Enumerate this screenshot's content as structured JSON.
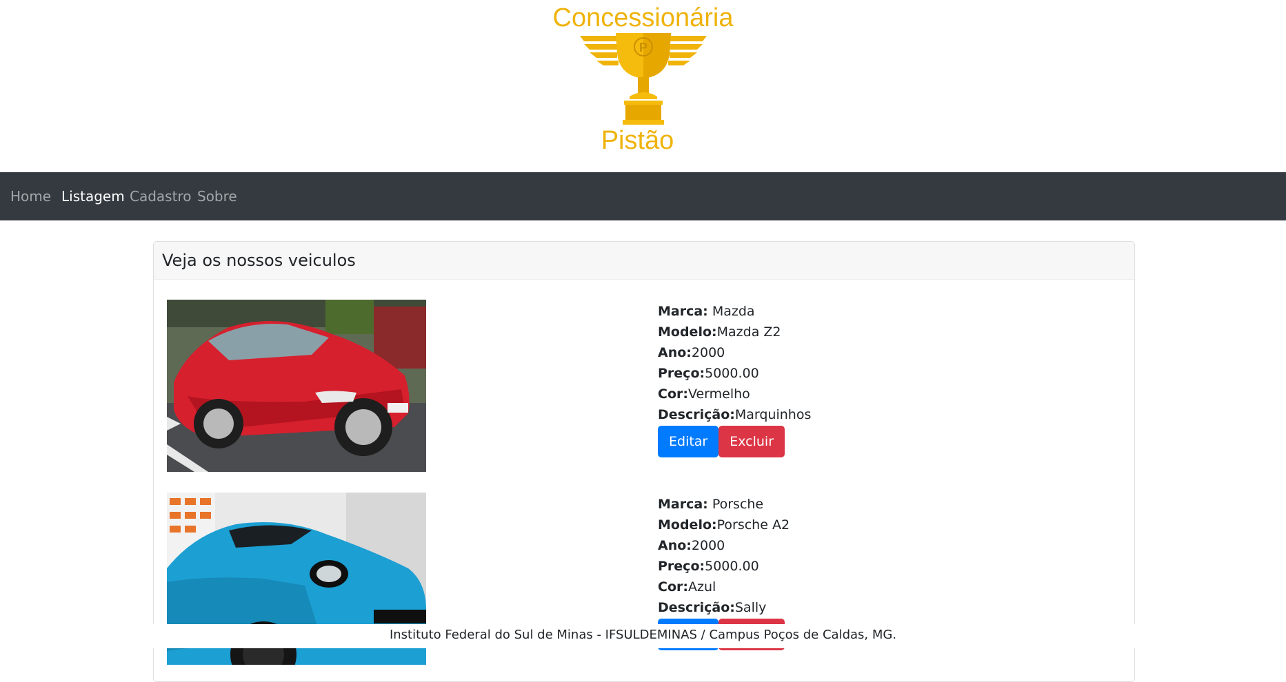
{
  "brand": {
    "name_top": "Concessionária",
    "name_bottom": "Pistão",
    "emblem_letter": "P",
    "color": "#efb30a"
  },
  "nav": {
    "items": [
      {
        "label": "Home"
      },
      {
        "label": "Listagem"
      },
      {
        "label": "Cadastro"
      },
      {
        "label": "Sobre"
      }
    ],
    "active": "Listagem",
    "background": "#343a40"
  },
  "listing": {
    "title": "Veja os nossos veiculos",
    "labels": {
      "marca": "Marca:",
      "modelo": "Modelo:",
      "ano": "Ano:",
      "preco": "Preço:",
      "cor": "Cor:",
      "descricao": "Descrição:"
    },
    "buttons": {
      "edit": "Editar",
      "delete": "Excluir"
    },
    "vehicles": [
      {
        "marca": "Mazda",
        "modelo": "Mazda Z2",
        "ano": "2000",
        "preco": "5000.00",
        "cor": "Vermelho",
        "descricao": "Marquinhos",
        "photo_color": "#d6202e"
      },
      {
        "marca": "Porsche",
        "modelo": "Porsche A2",
        "ano": "2000",
        "preco": "5000.00",
        "cor": "Azul",
        "descricao": "Sally",
        "photo_color": "#1c9fd3"
      }
    ]
  },
  "footer": {
    "text": "Instituto Federal do Sul de Minas - IFSULDEMINAS / Campus Poços de Caldas, MG."
  },
  "colors": {
    "edit_button": "#007bff",
    "delete_button": "#dc3545"
  }
}
